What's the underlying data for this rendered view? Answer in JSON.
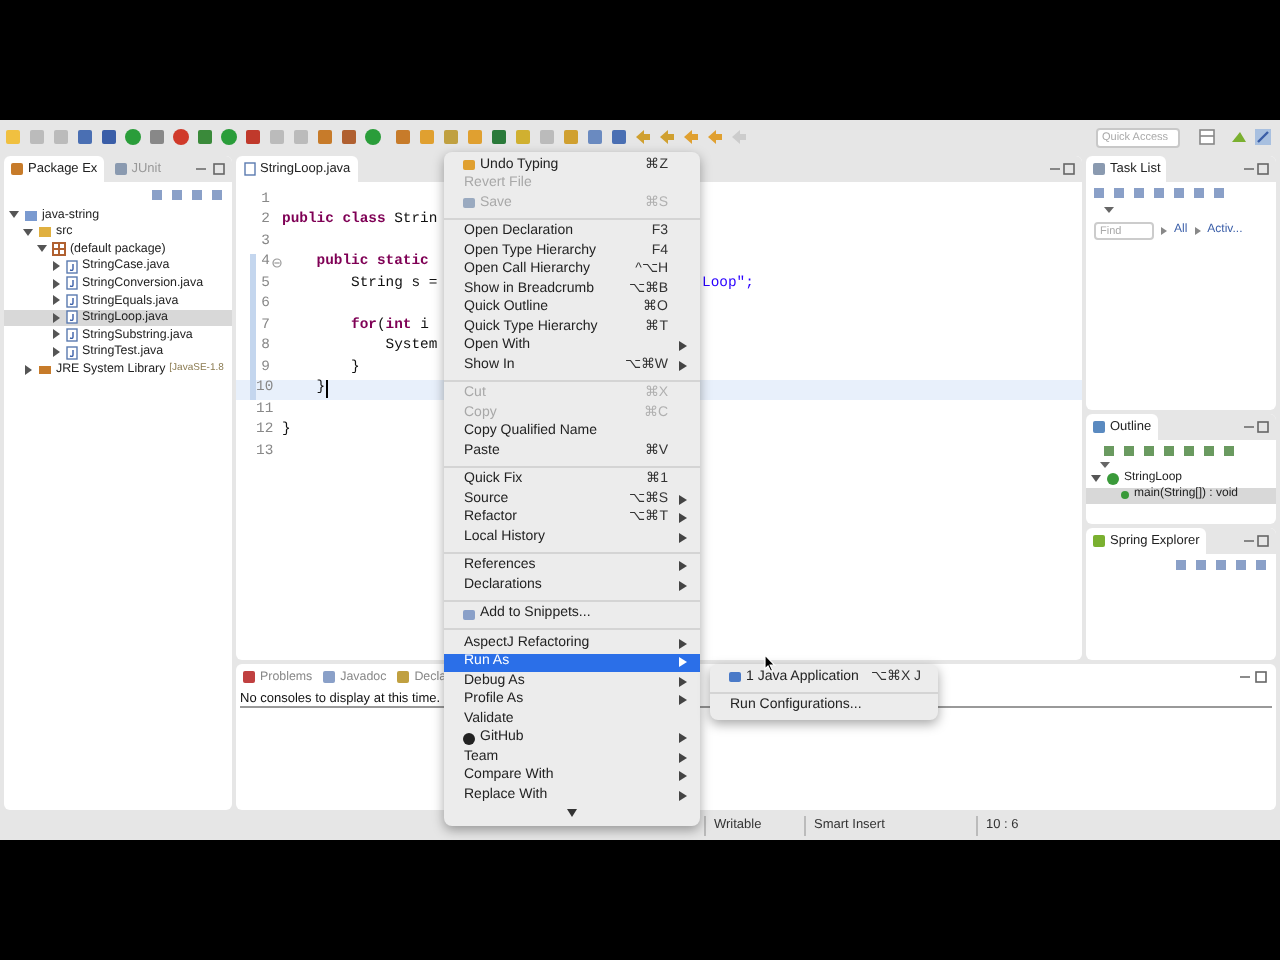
{
  "toolbar": {
    "quick_access": {
      "placeholder": "Quick Access"
    }
  },
  "package_explorer": {
    "tabs": [
      {
        "label": "Package Ex",
        "selected": true
      },
      {
        "label": "JUnit",
        "selected": false
      }
    ],
    "tree": [
      {
        "label": "java-string",
        "expanded": true,
        "selected": false,
        "children": [
          {
            "label": "src",
            "expanded": true,
            "selected": false,
            "children": [
              {
                "label": "(default package)",
                "expanded": true,
                "selected": false,
                "children": [
                  {
                    "label": "StringCase.java",
                    "expanded": false,
                    "selected": false
                  },
                  {
                    "label": "StringConversion.java",
                    "expanded": false,
                    "selected": false
                  },
                  {
                    "label": "StringEquals.java",
                    "expanded": false,
                    "selected": false
                  },
                  {
                    "label": "StringLoop.java",
                    "expanded": false,
                    "selected": true
                  },
                  {
                    "label": "StringSubstring.java",
                    "expanded": false,
                    "selected": false
                  },
                  {
                    "label": "StringTest.java",
                    "expanded": false,
                    "selected": false
                  }
                ]
              }
            ]
          },
          {
            "label": "JRE System Library",
            "suffix": "[JavaSE-1.8",
            "expanded": false,
            "selected": false
          }
        ]
      }
    ]
  },
  "editor": {
    "tab": "StringLoop.java",
    "lines": [
      {
        "number": "1",
        "current": false,
        "in_range": false,
        "fold": false
      },
      {
        "number": "2",
        "text": "**public class** Strin",
        "current": false,
        "in_range": false,
        "fold": false
      },
      {
        "number": "3",
        "current": false,
        "in_range": false,
        "fold": false
      },
      {
        "number": "4",
        "text": "    **public static**",
        "current": false,
        "in_range": true,
        "fold": true
      },
      {
        "number": "5",
        "text": "        String s =",
        "tail": "Loop\";",
        "current": false,
        "in_range": true,
        "fold": false
      },
      {
        "number": "6",
        "current": false,
        "in_range": true,
        "fold": false
      },
      {
        "number": "7",
        "text": "        **for**(**int** i",
        "current": false,
        "in_range": true,
        "fold": false
      },
      {
        "number": "8",
        "text": "            System",
        "current": false,
        "in_range": true,
        "fold": false
      },
      {
        "number": "9",
        "text": "        }",
        "current": false,
        "in_range": true,
        "fold": false
      },
      {
        "number": "10",
        "text": "    }",
        "current": true,
        "in_range": true,
        "fold": false
      },
      {
        "number": "11",
        "current": false,
        "in_range": false,
        "fold": false
      },
      {
        "number": "12",
        "text": "}",
        "current": false,
        "in_range": false,
        "fold": false
      },
      {
        "number": "13",
        "current": false,
        "in_range": false,
        "fold": false
      }
    ]
  },
  "console": {
    "tabs": [
      {
        "label": "Problems",
        "selected": false
      },
      {
        "label": "Javadoc",
        "selected": false
      },
      {
        "label": "Decla",
        "selected": false
      }
    ],
    "message": "No consoles to display at this time."
  },
  "task_list": {
    "title": "Task List",
    "find": {
      "placeholder": "Find"
    },
    "links": [
      "All",
      "Activ..."
    ]
  },
  "outline": {
    "title": "Outline",
    "tree": [
      {
        "label": "StringLoop",
        "expanded": true,
        "selected": false,
        "children": [
          {
            "label": "main(String[]) : void",
            "selected": true
          }
        ]
      }
    ]
  },
  "spring_explorer": {
    "title": "Spring Explorer"
  },
  "status_bar": [
    "Writable",
    "Smart Insert",
    "10 : 6"
  ],
  "context_menu": [
    {
      "kind": "item",
      "label": "Undo Typing",
      "shortcut": "⌘Z",
      "icon": true,
      "disabled": false,
      "submenu": false,
      "selected": false
    },
    {
      "kind": "item",
      "label": "Revert File",
      "disabled": true,
      "icon": false,
      "submenu": false,
      "selected": false
    },
    {
      "kind": "item",
      "label": "Save",
      "shortcut": "⌘S",
      "icon": true,
      "disabled": true,
      "submenu": false,
      "selected": false
    },
    {
      "kind": "separator"
    },
    {
      "kind": "item",
      "label": "Open Declaration",
      "shortcut": "F3",
      "icon": false,
      "disabled": false,
      "submenu": false,
      "selected": false
    },
    {
      "kind": "item",
      "label": "Open Type Hierarchy",
      "shortcut": "F4",
      "icon": false,
      "disabled": false,
      "submenu": false,
      "selected": false
    },
    {
      "kind": "item",
      "label": "Open Call Hierarchy",
      "shortcut": "^⌥H",
      "icon": false,
      "disabled": false,
      "submenu": false,
      "selected": false
    },
    {
      "kind": "item",
      "label": "Show in Breadcrumb",
      "shortcut": "⌥⌘B",
      "icon": false,
      "disabled": false,
      "submenu": false,
      "selected": false
    },
    {
      "kind": "item",
      "label": "Quick Outline",
      "shortcut": "⌘O",
      "icon": false,
      "disabled": false,
      "submenu": false,
      "selected": false
    },
    {
      "kind": "item",
      "label": "Quick Type Hierarchy",
      "shortcut": "⌘T",
      "icon": false,
      "disabled": false,
      "submenu": false,
      "selected": false
    },
    {
      "kind": "item",
      "label": "Open With",
      "icon": false,
      "disabled": false,
      "submenu": true,
      "selected": false
    },
    {
      "kind": "item",
      "label": "Show In",
      "shortcut": "⌥⌘W",
      "icon": false,
      "disabled": false,
      "submenu": true,
      "selected": false
    },
    {
      "kind": "separator"
    },
    {
      "kind": "item",
      "label": "Cut",
      "shortcut": "⌘X",
      "icon": false,
      "disabled": true,
      "submenu": false,
      "selected": false
    },
    {
      "kind": "item",
      "label": "Copy",
      "shortcut": "⌘C",
      "icon": false,
      "disabled": true,
      "submenu": false,
      "selected": false
    },
    {
      "kind": "item",
      "label": "Copy Qualified Name",
      "icon": false,
      "disabled": false,
      "submenu": false,
      "selected": false
    },
    {
      "kind": "item",
      "label": "Paste",
      "shortcut": "⌘V",
      "icon": false,
      "disabled": false,
      "submenu": false,
      "selected": false
    },
    {
      "kind": "separator"
    },
    {
      "kind": "item",
      "label": "Quick Fix",
      "shortcut": "⌘1",
      "icon": false,
      "disabled": false,
      "submenu": false,
      "selected": false
    },
    {
      "kind": "item",
      "label": "Source",
      "shortcut": "⌥⌘S",
      "icon": false,
      "disabled": false,
      "submenu": true,
      "selected": false
    },
    {
      "kind": "item",
      "label": "Refactor",
      "shortcut": "⌥⌘T",
      "icon": false,
      "disabled": false,
      "submenu": true,
      "selected": false
    },
    {
      "kind": "item",
      "label": "Local History",
      "icon": false,
      "disabled": false,
      "submenu": true,
      "selected": false
    },
    {
      "kind": "separator"
    },
    {
      "kind": "item",
      "label": "References",
      "icon": false,
      "disabled": false,
      "submenu": true,
      "selected": false
    },
    {
      "kind": "item",
      "label": "Declarations",
      "icon": false,
      "disabled": false,
      "submenu": true,
      "selected": false
    },
    {
      "kind": "separator"
    },
    {
      "kind": "item",
      "label": "Add to Snippets...",
      "icon": true,
      "disabled": false,
      "submenu": false,
      "selected": false
    },
    {
      "kind": "separator"
    },
    {
      "kind": "item",
      "label": "AspectJ Refactoring",
      "icon": false,
      "disabled": false,
      "submenu": true,
      "selected": false
    },
    {
      "kind": "item",
      "label": "Run As",
      "icon": false,
      "disabled": false,
      "submenu": true,
      "selected": true
    },
    {
      "kind": "item",
      "label": "Debug As",
      "icon": false,
      "disabled": false,
      "submenu": true,
      "selected": false
    },
    {
      "kind": "item",
      "label": "Profile As",
      "icon": false,
      "disabled": false,
      "submenu": true,
      "selected": false
    },
    {
      "kind": "item",
      "label": "Validate",
      "icon": false,
      "disabled": false,
      "submenu": false,
      "selected": false
    },
    {
      "kind": "item",
      "label": "GitHub",
      "icon": true,
      "disabled": false,
      "submenu": true,
      "selected": false
    },
    {
      "kind": "item",
      "label": "Team",
      "icon": false,
      "disabled": false,
      "submenu": true,
      "selected": false
    },
    {
      "kind": "item",
      "label": "Compare With",
      "icon": false,
      "disabled": false,
      "submenu": true,
      "selected": false
    },
    {
      "kind": "item",
      "label": "Replace With",
      "icon": false,
      "disabled": false,
      "submenu": true,
      "selected": false
    }
  ],
  "submenu": [
    {
      "kind": "item",
      "label": "1 Java Application",
      "shortcut": "⌥⌘X J",
      "icon": true
    },
    {
      "kind": "separator"
    },
    {
      "kind": "item",
      "label": "Run Configurations...",
      "icon": false
    }
  ]
}
